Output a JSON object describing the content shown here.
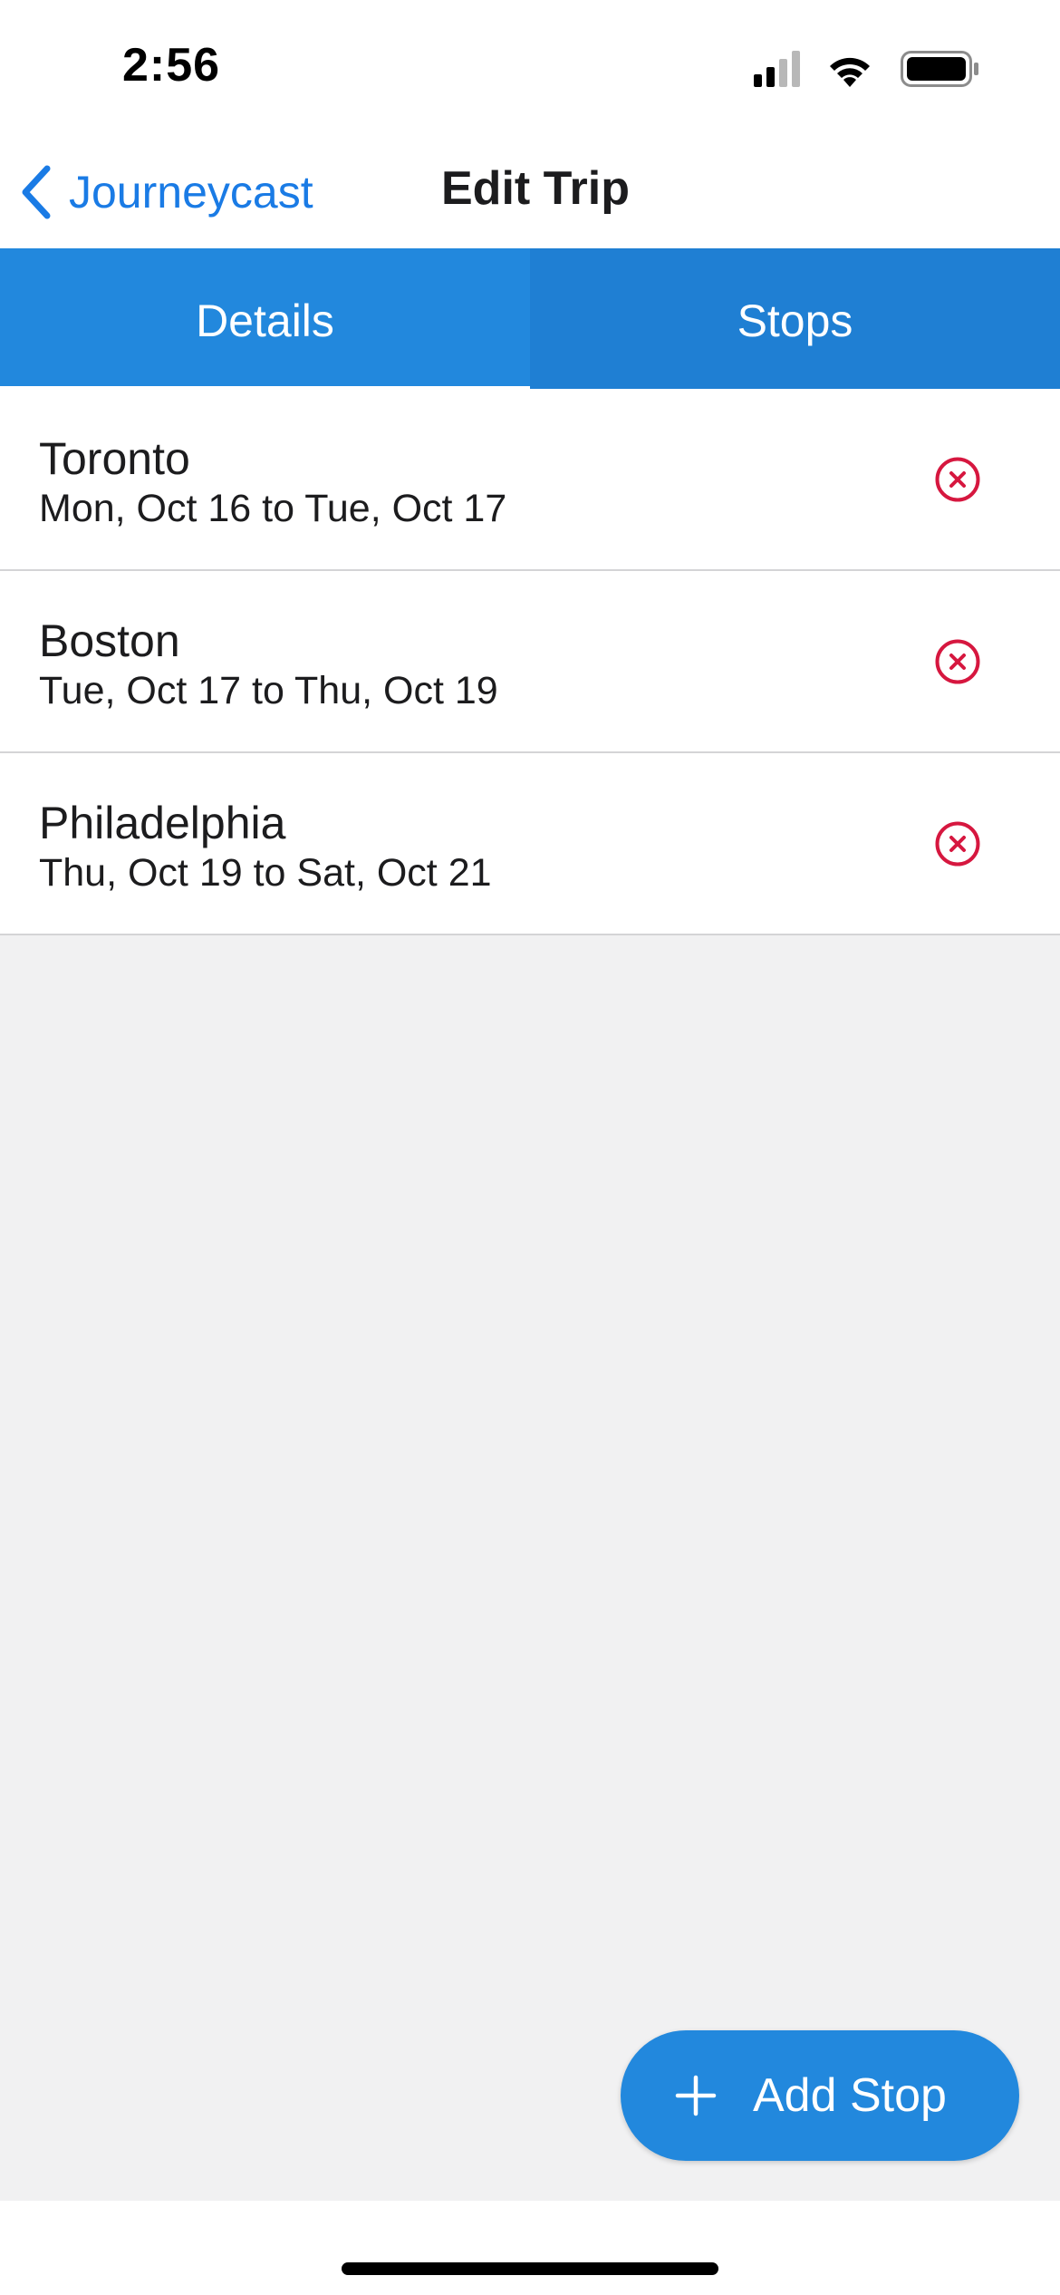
{
  "status_bar": {
    "time": "2:56",
    "icons": [
      "cellular-signal-icon",
      "wifi-icon",
      "battery-icon"
    ]
  },
  "nav": {
    "back_label": "Journeycast",
    "title": "Edit Trip"
  },
  "tabs": [
    {
      "label": "Details",
      "selected": true
    },
    {
      "label": "Stops",
      "selected": false
    }
  ],
  "stops": [
    {
      "name": "Toronto",
      "dates": "Mon, Oct 16 to Tue, Oct 17"
    },
    {
      "name": "Boston",
      "dates": "Tue, Oct 17 to Thu, Oct 19"
    },
    {
      "name": "Philadelphia",
      "dates": "Thu, Oct 19 to Sat, Oct 21"
    }
  ],
  "actions": {
    "add_stop_label": "Add Stop"
  },
  "colors": {
    "accent": "#2288dd",
    "link": "#1a7be5",
    "remove": "#d6173f",
    "background": "#f1f1f2"
  }
}
